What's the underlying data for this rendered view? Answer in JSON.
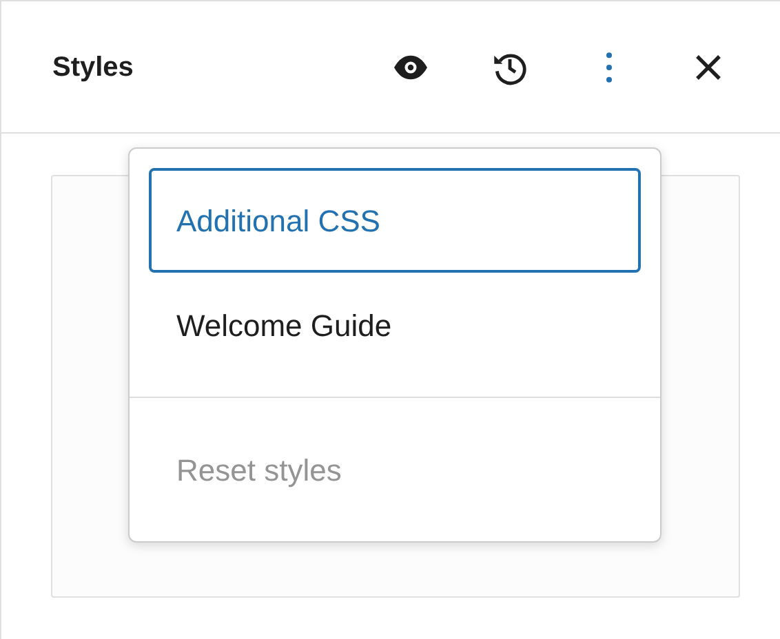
{
  "panel": {
    "title": "Styles"
  },
  "header_buttons": [
    {
      "kind": "preview",
      "expanded": false
    },
    {
      "kind": "revisions",
      "expanded": false
    },
    {
      "kind": "options",
      "expanded": true
    },
    {
      "kind": "close",
      "expanded": false
    }
  ],
  "menu": {
    "groups": [
      {
        "items": [
          {
            "label": "Additional CSS",
            "selected": true,
            "disabled": false
          },
          {
            "label": "Welcome Guide",
            "selected": false,
            "disabled": false
          }
        ]
      },
      {
        "items": [
          {
            "label": "Reset styles",
            "selected": false,
            "disabled": true
          }
        ]
      }
    ]
  }
}
